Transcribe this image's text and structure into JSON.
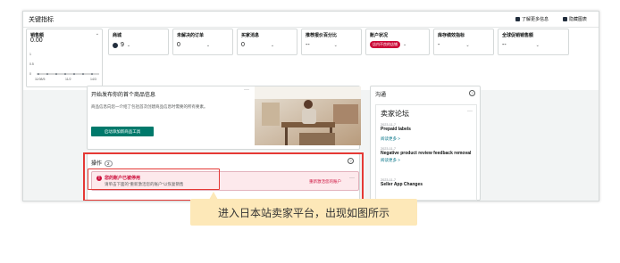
{
  "header": {
    "title": "关键指标",
    "learn_more": "了解更多信息",
    "hide_chart": "隐藏图表"
  },
  "metrics": [
    {
      "title": "销售额",
      "value": "0.00",
      "chart_ticks": [
        "11/08/5",
        "11/2",
        "14/3"
      ],
      "y_ticks": [
        "1",
        "0.5",
        "0"
      ]
    },
    {
      "title": "商城",
      "value": "9",
      "icon": "globe-icon"
    },
    {
      "title": "未解决的订单",
      "value": "0"
    },
    {
      "title": "买家消息",
      "value": "0"
    },
    {
      "title": "推荐报价百分比",
      "value": "--"
    },
    {
      "title": "账户状况",
      "badge": "店内不良的店铺"
    },
    {
      "title": "库存绩效指标",
      "value": "-"
    },
    {
      "title": "全球促销销售额",
      "value": "--"
    }
  ],
  "start_panel": {
    "title": "开始发布你的首个商品信息",
    "text": "商品信息向您一介绍了包括首次创建商品信息时需要的所有要素。",
    "button": "启动添加新商品工具"
  },
  "actions_panel": {
    "title": "操作",
    "count": "2",
    "alert_title": "您的账户已被停用",
    "alert_text": "请单击下面的“重新激活您的账户”以恢复销售",
    "alert_link": "重新激活您的账户"
  },
  "news_panel": {
    "title": "沟通",
    "forum_title": "卖家论坛",
    "items": [
      {
        "date": "2023-11-7",
        "title": "Prepaid labels",
        "link": "阅读更多 >"
      },
      {
        "date": "2023-11-7",
        "title": "Negative product review feedback removal",
        "link": "阅读更多 >"
      },
      {
        "date": "2023-11-7",
        "title": "Seller App Changes",
        "link": ""
      }
    ]
  },
  "caption": "进入日本站卖家平台，出现如图所示",
  "colors": {
    "teal": "#00796b",
    "alert_red": "#cc0c39",
    "highlight": "#e53935",
    "caption_bg": "#fde8b8"
  }
}
